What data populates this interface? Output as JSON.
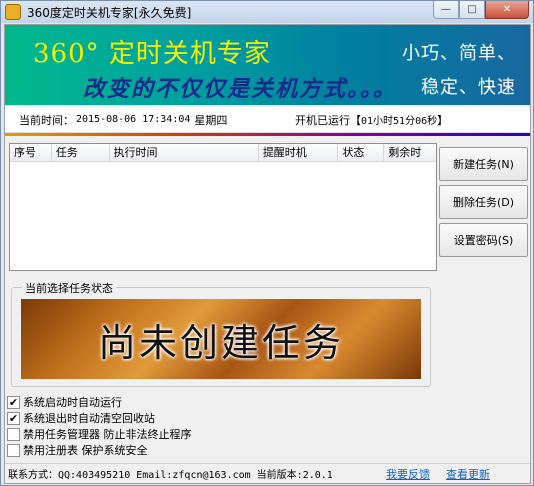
{
  "window": {
    "title": "360度定时关机专家[永久免费]",
    "buttons": {
      "minimize": "—",
      "maximize": "□",
      "close": "✕"
    }
  },
  "banner": {
    "title": "360°  定时关机专家",
    "slogan": "改变的不仅仅是关机方式。。。",
    "right_line1": "小巧、简单、",
    "right_line2": "稳定、快速"
  },
  "status": {
    "current_time_label": "当前时间：",
    "current_time_value": "2015-08-06 17:34:04",
    "weekday": "星期四",
    "uptime_label": "开机已运行【",
    "uptime_value": "01小时51分06秒",
    "uptime_suffix": "】"
  },
  "task_table": {
    "columns": [
      "序号",
      "任务",
      "执行时间",
      "提醒时机",
      "状态",
      "剩余时"
    ],
    "rows": []
  },
  "actions": {
    "new_task": "新建任务(N)",
    "delete_task": "删除任务(D)",
    "set_password": "设置密码(S)"
  },
  "task_status": {
    "legend": "当前选择任务状态",
    "message": "尚未创建任务"
  },
  "options": [
    {
      "label": "系统启动时自动运行",
      "checked": true
    },
    {
      "label": "系统退出时自动清空回收站",
      "checked": true
    },
    {
      "label": "禁用任务管理器 防止非法终止程序",
      "checked": false
    },
    {
      "label": "禁用注册表 保护系统安全",
      "checked": false
    }
  ],
  "footer": {
    "contact": "联系方式：QQ:403495210 Email:zfqcn@163.com 当前版本:2.0.1",
    "feedback_link": "我要反馈",
    "update_link": "查看更新"
  }
}
